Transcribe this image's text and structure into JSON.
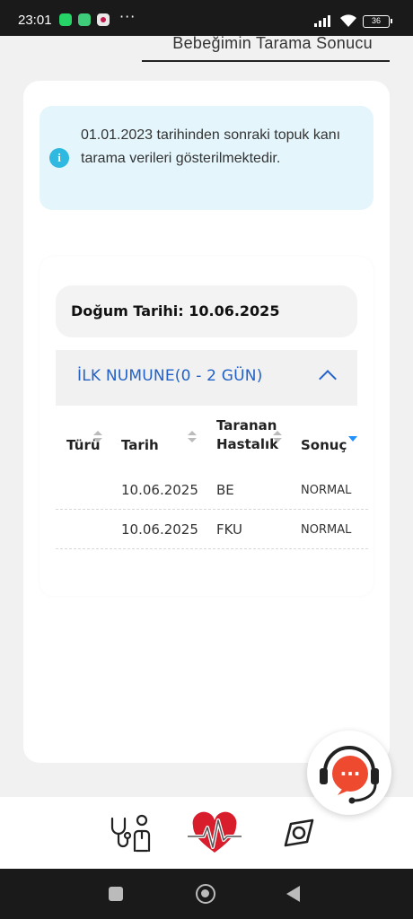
{
  "status_bar": {
    "time": "23:01",
    "more": "···",
    "battery": "36",
    "notification_icons": [
      "whatsapp-icon",
      "app-notification-icon",
      "app-notification-icon"
    ]
  },
  "header": {
    "title": "Bebeğimin Tarama Sonucu"
  },
  "info": {
    "icon": "info-icon",
    "icon_glyph": "i",
    "message": "01.01.2023 tarihinden sonraki topuk kanı tarama verileri gösterilmektedir."
  },
  "birth": {
    "label": "Doğum Tarihi: 10.06.2025"
  },
  "section": {
    "title": "İLK NUMUNE(0 - 2 GÜN)",
    "expanded": true
  },
  "table": {
    "headers": {
      "type": "Türü",
      "date": "Tarih",
      "disease_line1": "Taranan",
      "disease_line2": "Hastalık",
      "result": "Sonuç"
    },
    "rows": [
      {
        "type": "",
        "date": "10.06.2025",
        "disease": "BE",
        "result": "NORMAL"
      },
      {
        "type": "",
        "date": "10.06.2025",
        "disease": "FKU",
        "result": "NORMAL"
      }
    ]
  },
  "chat": {
    "icon": "support-chat-icon",
    "dots": "···"
  },
  "bottom_nav": {
    "items": [
      {
        "icon": "doctor-stethoscope-icon"
      },
      {
        "icon": "heart-pulse-logo-icon"
      },
      {
        "icon": "eye-icon"
      }
    ]
  },
  "colors": {
    "accent_blue": "#2262c8",
    "info_bg": "#e4f6fc",
    "info_icon": "#2fb8e0",
    "chat_red": "#ee4a30",
    "heart_red": "#d81d2c"
  }
}
